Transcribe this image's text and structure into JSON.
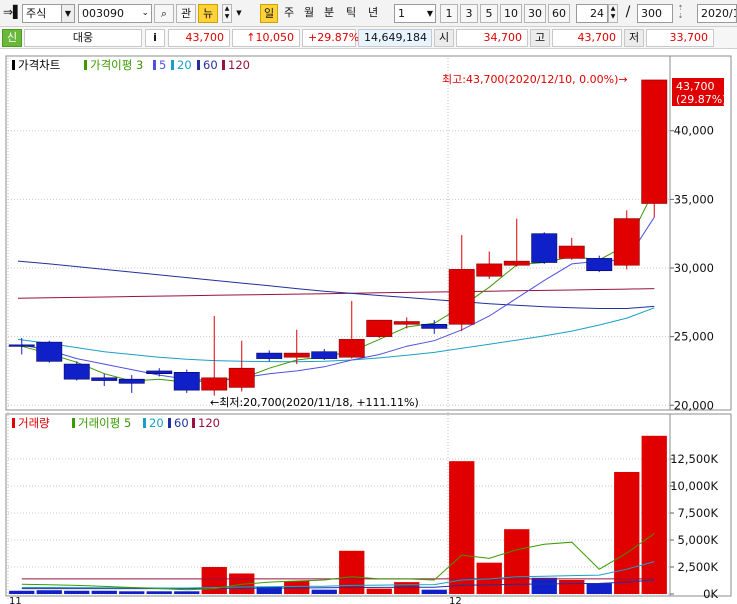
{
  "toolbar": {
    "market": "주식",
    "code": "003090",
    "btn_watch": "관",
    "btn_news": "뉴",
    "periods": [
      "일",
      "주",
      "월",
      "분",
      "틱",
      "년"
    ],
    "interval_select": "1",
    "intervals": [
      "1",
      "3",
      "5",
      "10",
      "30",
      "60"
    ],
    "zoom_value": "24",
    "slash": "/",
    "total_value": "300",
    "date": "2020/1"
  },
  "quote": {
    "badge": "신",
    "name": "대웅",
    "info": "i",
    "price": "43,700",
    "change": "↑10,050",
    "change_pct": "+29.87%",
    "volume": "14,649,184",
    "open_label": "시",
    "open": "34,700",
    "high_label": "고",
    "high": "43,700",
    "low_label": "저",
    "low": "33,700"
  },
  "colors": {
    "up": "#e00000",
    "down": "#1020c8",
    "ma3": "#3a9a00",
    "ma5": "#5050e0",
    "ma20": "#18a0c8",
    "ma60": "#2030a0",
    "ma120": "#9a1040"
  },
  "chart_data": [
    {
      "type": "candlestick",
      "legend": [
        {
          "label": "가격차트",
          "color": "#000000"
        },
        {
          "label": "가격이평 3",
          "color": "#3a9a00"
        },
        {
          "label": "5",
          "color": "#5050e0"
        },
        {
          "label": "20",
          "color": "#18a0c8"
        },
        {
          "label": "60",
          "color": "#2030a0"
        },
        {
          "label": "120",
          "color": "#9a1040"
        }
      ],
      "y_ticks": [
        {
          "value": 40000,
          "label": "40,000"
        },
        {
          "value": 35000,
          "label": "35,000"
        },
        {
          "value": 30000,
          "label": "30,000"
        },
        {
          "value": 25000,
          "label": "25,000"
        },
        {
          "value": 20000,
          "label": "20,000"
        }
      ],
      "ylim": [
        19800,
        45300
      ],
      "x_labels": [
        {
          "index": 0,
          "label": "11"
        },
        {
          "index": 16,
          "label": "12"
        }
      ],
      "candles": [
        {
          "o": 24400,
          "h": 24900,
          "l": 23700,
          "c": 24300
        },
        {
          "o": 24600,
          "h": 24700,
          "l": 23100,
          "c": 23200
        },
        {
          "o": 23000,
          "h": 23200,
          "l": 21800,
          "c": 21900
        },
        {
          "o": 22000,
          "h": 22300,
          "l": 21400,
          "c": 21800
        },
        {
          "o": 21900,
          "h": 22200,
          "l": 20900,
          "c": 21600
        },
        {
          "o": 22500,
          "h": 22700,
          "l": 22100,
          "c": 22300
        },
        {
          "o": 22400,
          "h": 22600,
          "l": 20900,
          "c": 21100
        },
        {
          "o": 21100,
          "h": 26500,
          "l": 20700,
          "c": 22000
        },
        {
          "o": 21300,
          "h": 24700,
          "l": 21000,
          "c": 22700
        },
        {
          "o": 23800,
          "h": 24000,
          "l": 23200,
          "c": 23400
        },
        {
          "o": 23500,
          "h": 25500,
          "l": 23000,
          "c": 23800
        },
        {
          "o": 23900,
          "h": 24100,
          "l": 23300,
          "c": 23400
        },
        {
          "o": 23500,
          "h": 27600,
          "l": 23400,
          "c": 24800
        },
        {
          "o": 25000,
          "h": 26200,
          "l": 24900,
          "c": 26200
        },
        {
          "o": 25900,
          "h": 26400,
          "l": 25600,
          "c": 26100
        },
        {
          "o": 25900,
          "h": 26200,
          "l": 25200,
          "c": 25600
        },
        {
          "o": 25900,
          "h": 32400,
          "l": 25400,
          "c": 29900
        },
        {
          "o": 29400,
          "h": 31200,
          "l": 29200,
          "c": 30300
        },
        {
          "o": 30200,
          "h": 33600,
          "l": 30100,
          "c": 30500
        },
        {
          "o": 32500,
          "h": 32600,
          "l": 30300,
          "c": 30400
        },
        {
          "o": 30700,
          "h": 32200,
          "l": 30600,
          "c": 31600
        },
        {
          "o": 30700,
          "h": 30900,
          "l": 29700,
          "c": 29800
        },
        {
          "o": 30200,
          "h": 34200,
          "l": 29900,
          "c": 33600
        },
        {
          "o": 34700,
          "h": 43700,
          "l": 33700,
          "c": 43700
        }
      ],
      "ma3": [
        24300,
        23750,
        23130,
        22300,
        21770,
        21900,
        21670,
        21800,
        21930,
        22700,
        23300,
        23530,
        23930,
        24800,
        25700,
        25970,
        27200,
        28600,
        30230,
        30400,
        30830,
        30600,
        31670,
        35700
      ],
      "ma5": [
        24400,
        24000,
        23400,
        23000,
        22600,
        22200,
        21900,
        21800,
        22000,
        22300,
        22500,
        22800,
        23300,
        23700,
        24300,
        24700,
        25500,
        26500,
        27800,
        29100,
        30300,
        30500,
        30600,
        33700
      ],
      "ma20": [
        24800,
        24500,
        24200,
        23900,
        23700,
        23500,
        23350,
        23250,
        23200,
        23180,
        23170,
        23200,
        23300,
        23450,
        23650,
        23850,
        24150,
        24450,
        24750,
        25050,
        25400,
        25850,
        26350,
        27100
      ],
      "ma60": [
        30500,
        30300,
        30100,
        29900,
        29700,
        29500,
        29300,
        29100,
        28900,
        28700,
        28500,
        28300,
        28150,
        28000,
        27850,
        27700,
        27550,
        27400,
        27280,
        27180,
        27100,
        27050,
        27050,
        27200
      ],
      "ma120": [
        27800,
        27830,
        27860,
        27890,
        27920,
        27950,
        27980,
        28010,
        28040,
        28070,
        28100,
        28130,
        28160,
        28190,
        28220,
        28250,
        28280,
        28310,
        28340,
        28370,
        28400,
        28430,
        28460,
        28500
      ],
      "current_label": {
        "price": "43,700",
        "pct": "(29.87%)"
      },
      "annotations": {
        "high": "최고:43,700(2020/12/10, 0.00%)→",
        "low": "←최저:20,700(2020/11/18, +111.11%)"
      }
    },
    {
      "type": "bar",
      "legend": [
        {
          "label": "거래량",
          "color": "#e00000"
        },
        {
          "label": "거래이평 5",
          "color": "#3a9a00"
        },
        {
          "label": "20",
          "color": "#18a0c8"
        },
        {
          "label": "60",
          "color": "#2030a0"
        },
        {
          "label": "120",
          "color": "#9a1040"
        }
      ],
      "y_ticks": [
        {
          "value": 12500,
          "label": "12,500K"
        },
        {
          "value": 10000,
          "label": "10,000K"
        },
        {
          "value": 7500,
          "label": "7,500K"
        },
        {
          "value": 5000,
          "label": "5,000K"
        },
        {
          "value": 2500,
          "label": "2,500K"
        },
        {
          "value": 0,
          "label": "0K"
        }
      ],
      "ylim": [
        0,
        15000
      ],
      "values": [
        300,
        350,
        300,
        300,
        250,
        250,
        250,
        2500,
        1900,
        700,
        1200,
        400,
        4000,
        500,
        1100,
        400,
        12300,
        2900,
        6000,
        1500,
        1300,
        1000,
        11300,
        14649
      ],
      "ma5": [
        900,
        850,
        800,
        700,
        600,
        500,
        400,
        500,
        900,
        1100,
        1200,
        1300,
        1600,
        1400,
        1400,
        1300,
        3600,
        3300,
        4100,
        4600,
        4800,
        2300,
        3800,
        5600
      ],
      "ma20": [
        600,
        600,
        590,
        580,
        570,
        560,
        560,
        600,
        650,
        680,
        700,
        720,
        800,
        820,
        850,
        870,
        1300,
        1400,
        1600,
        1650,
        1700,
        1750,
        2300,
        3000
      ],
      "ma60": [
        500,
        500,
        500,
        500,
        500,
        500,
        500,
        520,
        540,
        550,
        560,
        570,
        600,
        610,
        620,
        630,
        800,
        850,
        900,
        930,
        960,
        980,
        1100,
        1300
      ],
      "ma120": [
        1400,
        1400,
        1400,
        1400,
        1400,
        1400,
        1400,
        1400,
        1400,
        1400,
        1400,
        1400,
        1400,
        1400,
        1400,
        1400,
        1400,
        1400,
        1400,
        1400,
        1400,
        1400,
        1400,
        1400
      ]
    }
  ]
}
